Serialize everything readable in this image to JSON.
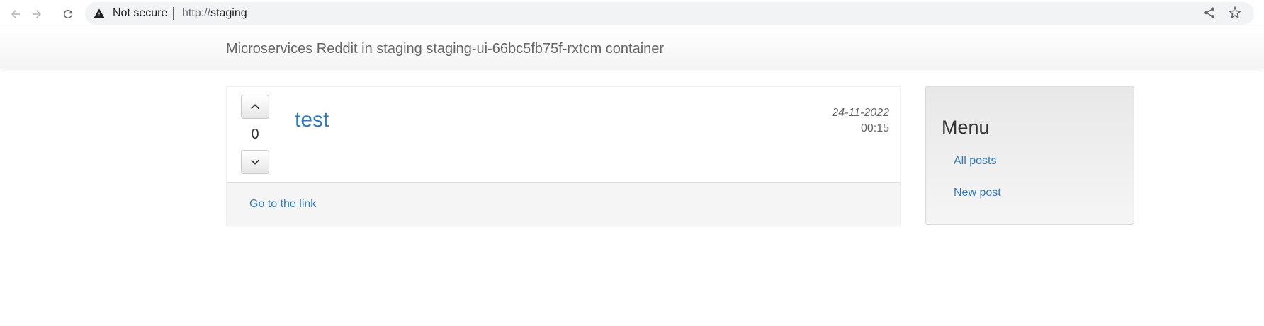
{
  "browser": {
    "security_label": "Not secure",
    "url_scheme": "http://",
    "url_host": "staging"
  },
  "navbar": {
    "brand": "Microservices Reddit in staging staging-ui-66bc5fb75f-rxtcm container"
  },
  "post": {
    "votes": "0",
    "title": "test",
    "date": "24-11-2022",
    "time": "00:15",
    "link_label": "Go to the link"
  },
  "sidebar": {
    "title": "Menu",
    "items": [
      {
        "label": "All posts"
      },
      {
        "label": "New post"
      }
    ]
  },
  "colors": {
    "link": "#337ab7",
    "brand_text": "#666666",
    "footer_bg": "#f5f5f5"
  },
  "icons": {
    "back": "arrow-left-icon",
    "forward": "arrow-right-icon",
    "reload": "reload-icon",
    "warning": "warning-triangle-icon",
    "share": "share-icon",
    "bookmark": "star-icon",
    "upvote": "chevron-up-icon",
    "downvote": "chevron-down-icon"
  }
}
